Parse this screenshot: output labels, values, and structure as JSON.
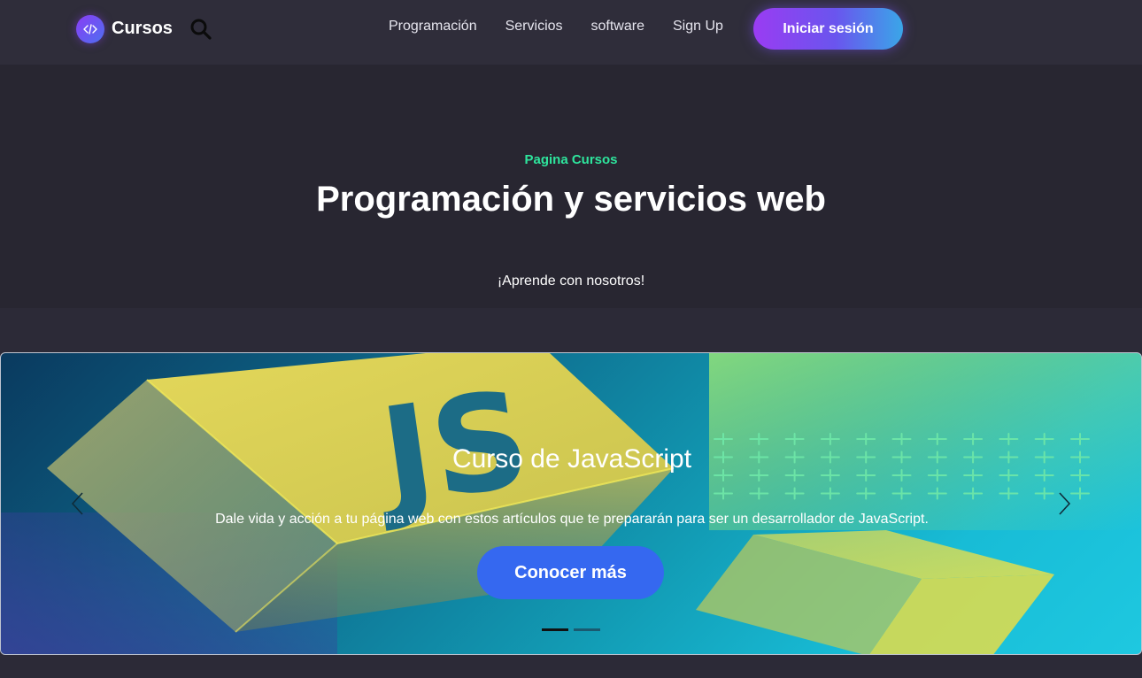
{
  "brand": {
    "name": "Cursos",
    "logo_icon": "code-icon"
  },
  "nav": {
    "search_icon": "search-icon",
    "links": [
      {
        "label": "Programación"
      },
      {
        "label": "Servicios"
      },
      {
        "label": "software"
      },
      {
        "label": "Sign Up"
      }
    ],
    "login_label": "Iniciar sesión"
  },
  "hero": {
    "eyebrow": "Pagina Cursos",
    "title": "Programación y servicios web",
    "subtitle": "¡Aprende con nosotros!"
  },
  "carousel": {
    "image_text": "JS",
    "slide_title": "Curso de JavaScript",
    "slide_description": "Dale vida y acción a tu página web con estos artículos que te prepararán para ser un desarrollador de JavaScript.",
    "cta_label": "Conocer más",
    "prev_icon": "chevron-left-icon",
    "next_icon": "chevron-right-icon",
    "indicators": [
      {
        "active": true
      },
      {
        "active": false
      }
    ]
  },
  "colors": {
    "nav_bg": "#2f2d3a",
    "hero_bg": "#282631",
    "page_bg": "#2c2a37",
    "accent_green": "#2ee59d",
    "cta_blue": "#3568f0",
    "login_gradient_start": "#9a3cf2",
    "login_gradient_end": "#3aa6e8"
  }
}
